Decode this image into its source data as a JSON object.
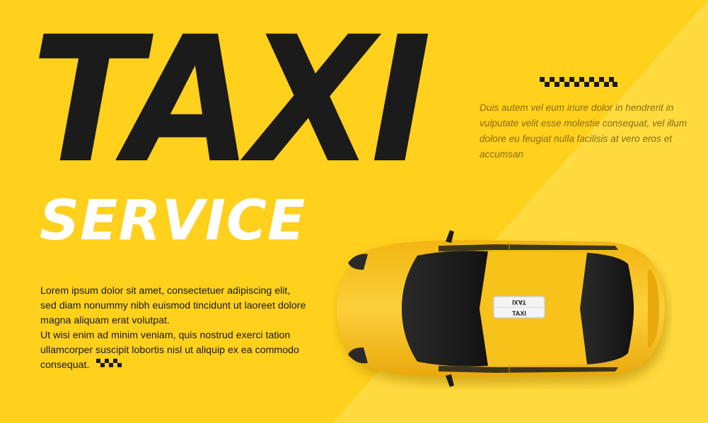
{
  "headline": {
    "title": "TAXI",
    "subtitle": "SERVICE"
  },
  "aside": {
    "text": "Duis autem vel eum iriure dolor in hendrerit in vulputate velit esse molestie consequat, vel illum dolore eu feugiat nulla facilisis at vero eros et accumsan"
  },
  "body": {
    "paragraph_1": "Lorem ipsum dolor sit amet, consectetuer adipiscing elit, sed diam nonummy nibh euismod tincidunt ut laoreet dolore magna aliquam erat volutpat.",
    "paragraph_2": "Ut wisi enim ad minim veniam, quis nostrud exerci tation ullamcorper suscipit lobortis nisl ut aliquip ex ea commodo consequat."
  },
  "car": {
    "roof_sign_text": "TAXI",
    "roof_sign_text_mirrored": "TAXI"
  },
  "colors": {
    "background": "#ffd01c",
    "background_light": "#ffdb3f",
    "title": "#1b1b1b",
    "subtitle": "#ffffff",
    "car_body": "#f7c21a",
    "glass": "#1c1c1c"
  },
  "icons": {
    "checker_strip": "checkered-taxi-stripe",
    "car": "taxi-car-top-view"
  }
}
